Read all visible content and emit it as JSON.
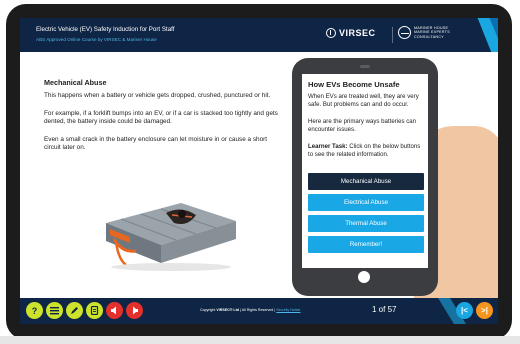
{
  "header": {
    "title": "Electric Vehicle (EV) Safety Induction for Port Staff",
    "subtitle": "ABS Approved Online Course by VIRSEC & Mariner House",
    "brand": "VIRSEC",
    "partner": [
      "MARINER HOUSE",
      "MARINE EXPERTS",
      "CONSULTANCY"
    ]
  },
  "content": {
    "heading": "Mechanical Abuse",
    "paragraphs": [
      "This happens when a battery or vehicle gets dropped, crushed, punctured or hit.",
      "For example, if a forklift bumps into an EV, or if a car is stacked too tightly and gets dented, the battery inside could be damaged.",
      "Even a small crack in the battery enclosure can let moisture in or cause a short circuit later on."
    ]
  },
  "phone": {
    "title": "How EVs Become Unsafe",
    "text1": "When EVs are treated well, they are very safe. But problems can and do occur.",
    "text2": "Here are the primary ways batteries can encounter issues.",
    "task_label": "Learner Task:",
    "task_text": " Click on the below buttons to see the related information.",
    "buttons": [
      "Mechanical Abuse",
      "Electrical Abuse",
      "Thermal Abuse",
      "Remember!"
    ]
  },
  "footer": {
    "copyright_pre": "Copyright ",
    "copyright_brand": "VIRSEC® Ltd",
    "copyright_post": " | All Rights Reserved  |  ",
    "security_link": "Security Notice",
    "page": "1 of 57"
  },
  "colors": {
    "navy": "#0f2545",
    "accent_blue": "#19a7e6",
    "lime": "#cde22b",
    "red": "#e2302d",
    "orange": "#f4951d"
  },
  "icons": [
    "help-icon",
    "menu-list-icon",
    "pencil-icon",
    "notes-icon",
    "audio-left-icon",
    "audio-right-icon",
    "previous-icon",
    "next-icon"
  ]
}
